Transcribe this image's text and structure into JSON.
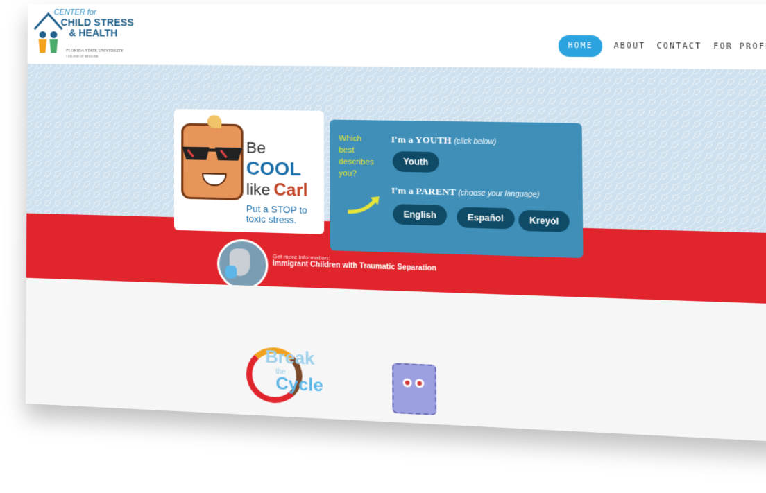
{
  "header": {
    "logo": {
      "center_for": "CENTER for",
      "line1": "CHILD STRESS",
      "line2": "& HEALTH",
      "university": "FLORIDA STATE UNIVERSITY",
      "college": "COLLEGE OF MEDICINE"
    },
    "nav": [
      {
        "label": "HOME",
        "active": true
      },
      {
        "label": "ABOUT",
        "active": false
      },
      {
        "label": "CONTACT",
        "active": false
      },
      {
        "label": "FOR PROFESSIONALS",
        "active": false
      }
    ]
  },
  "carl": {
    "be": "Be",
    "cool": "COOL",
    "like": "like",
    "name": "Carl",
    "tagline": "Put a STOP to toxic stress."
  },
  "choice": {
    "question_lines": [
      "Which",
      "best",
      "describes",
      "you?"
    ],
    "youth_heading": "I'm a YOUTH",
    "youth_hint": "(click below)",
    "youth_button": "Youth",
    "parent_heading": "I'm a PARENT",
    "parent_hint": "(choose your language)",
    "buttons": {
      "english": "English",
      "espanol": "Español",
      "kreyol": "Kreyól"
    }
  },
  "info": {
    "small": "Get more information:",
    "title": "Immigrant Children with Traumatic Separation"
  },
  "bottom": {
    "break_word1": "Break",
    "break_word2": "the",
    "break_word3": "Cycle"
  },
  "colors": {
    "nav_active": "#2aa3de",
    "red_band": "#e1252d",
    "choice_bg": "#3f8fb8",
    "button_bg": "#0f4b66",
    "question_text": "#e8e53a"
  }
}
